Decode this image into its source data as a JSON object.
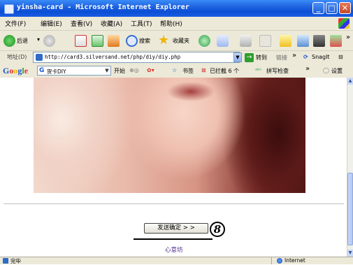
{
  "window": {
    "title": "yinsha-card - Microsoft Internet Explorer"
  },
  "menu": [
    "文件(F)",
    "编辑(E)",
    "查看(V)",
    "收藏(A)",
    "工具(T)",
    "帮助(H)"
  ],
  "toolbar": {
    "back_label": "后退",
    "search_label": "搜索",
    "favorites_label": "收藏夹"
  },
  "address": {
    "label": "地址(D)",
    "url": "http://card3.silversand.net/php/diy/diy.php",
    "go_label": "转到",
    "links_label": "链接",
    "snagit_label": "SnagIt"
  },
  "google_toolbar": {
    "logo": "Google",
    "search_value": "贺卡DIY",
    "start_label": "开始",
    "bookmarks_label": "书签",
    "blocked_label": "已拦截 6 个",
    "spellcheck_label": "拼写检查",
    "settings_label": "设置"
  },
  "content": {
    "send_button": "发送确定 > >",
    "badge_number": "8",
    "footer_link": "心意坊"
  },
  "status": {
    "text": "完毕",
    "zone": "Internet"
  }
}
